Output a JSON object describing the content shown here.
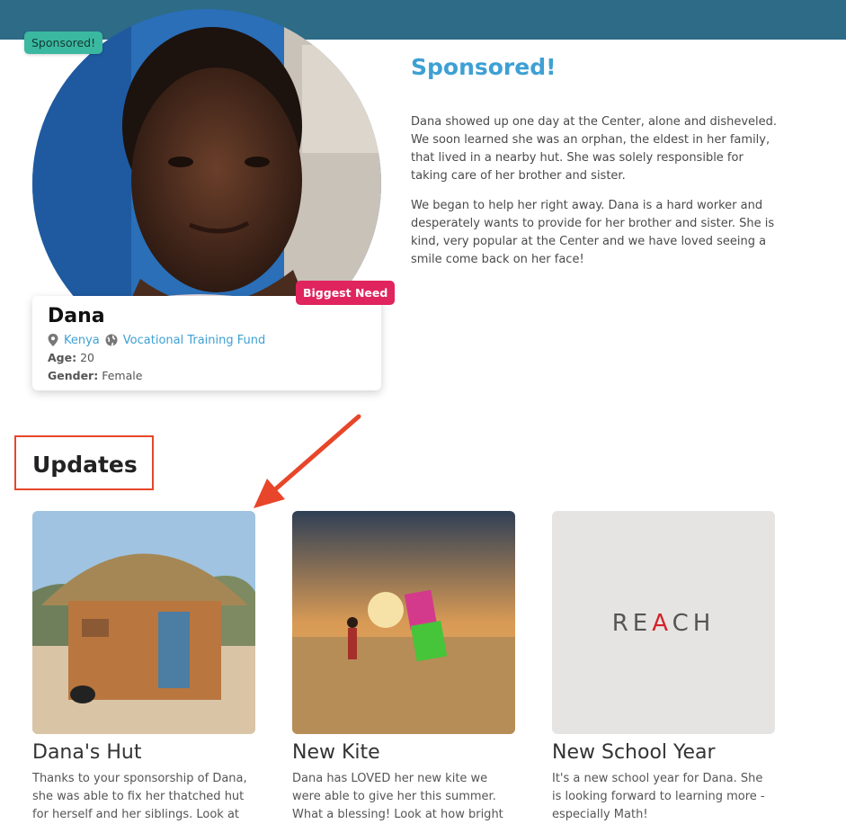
{
  "header": {},
  "profile": {
    "status_pill": "Sponsored!",
    "need_badge": "Biggest Need",
    "name": "Dana",
    "country": "Kenya",
    "fund": "Vocational Training Fund",
    "age_label": "Age:",
    "age": "20",
    "gender_label": "Gender:",
    "gender": "Female"
  },
  "story": {
    "title": "Sponsored!",
    "paragraphs": [
      "Dana showed up one day at the Center, alone and disheveled. We soon learned she was an orphan, the eldest in her family, that lived in a nearby hut. She was solely responsible for taking care of her brother and sister.",
      "We began to help her right away. Dana is a hard worker and desperately wants to provide for her brother and sister. She is kind, very popular at the Center and we have loved seeing a smile come back on her face!"
    ]
  },
  "updates": {
    "heading": "Updates",
    "items": [
      {
        "title": "Dana's Hut",
        "text": "Thanks to your sponsorship of Dana, she was able to fix her thatched hut for herself and her siblings. Look at"
      },
      {
        "title": "New Kite",
        "text": "Dana has LOVED her new kite we were able to give her this summer. What a blessing!  Look at how bright"
      },
      {
        "title": "New School Year",
        "text": "It's a new school year for Dana.  She is looking forward to learning more - especially Math!",
        "logo": "REACH"
      }
    ]
  },
  "colors": {
    "header_bar": "#2d6b87",
    "accent_blue": "#3ea0d4",
    "teal_pill": "#3bb9a0",
    "need_red": "#e0245e",
    "annotation_red": "#e8462a"
  },
  "icons": [
    "map-pin-icon",
    "globe-icon",
    "annotation-arrow"
  ]
}
